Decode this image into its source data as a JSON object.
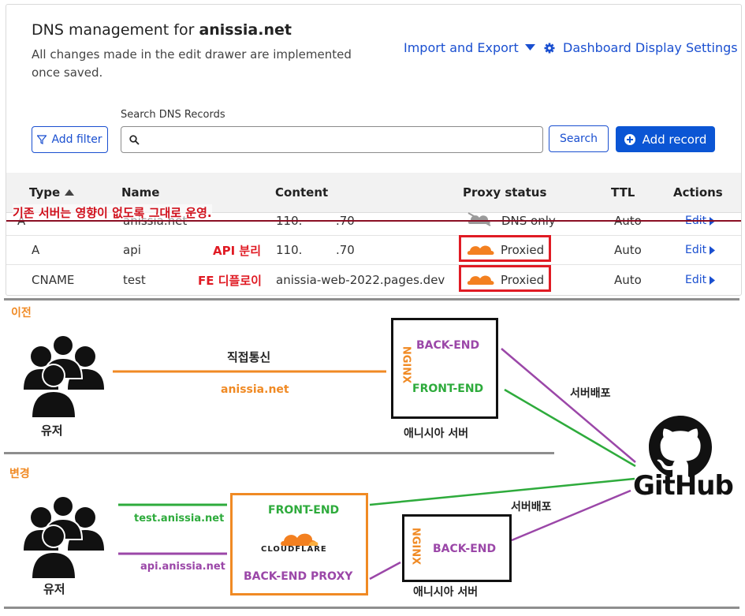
{
  "header": {
    "title_prefix": "DNS management for ",
    "title_domain": "anissia.net",
    "subtitle": "All changes made in the edit drawer are implemented once saved.",
    "import_export": "Import and Export",
    "dashboard_settings": "Dashboard Display Settings"
  },
  "toolbar": {
    "add_filter": "Add filter",
    "search_label": "Search DNS Records",
    "search_value": "",
    "search_button": "Search",
    "add_record": "Add record"
  },
  "table": {
    "columns": [
      "Type",
      "Name",
      "Content",
      "Proxy status",
      "TTL",
      "Actions"
    ],
    "rows": [
      {
        "type": "A",
        "name": "anissia.net",
        "content_a": "110.",
        "content_b": ".70",
        "proxy": "DNS only",
        "ttl": "Auto",
        "action": "Edit"
      },
      {
        "type": "A",
        "name": "api",
        "content_a": "110.",
        "content_b": ".70",
        "proxy": "Proxied",
        "ttl": "Auto",
        "action": "Edit"
      },
      {
        "type": "CNAME",
        "name": "test",
        "content_a": "anissia-web-2022.pages.dev",
        "content_b": "",
        "proxy": "Proxied",
        "ttl": "Auto",
        "action": "Edit"
      }
    ]
  },
  "annotations": {
    "strike_note": "기존 서버는 영향이 없도록 그대로 운영.",
    "api_note": "API 분리",
    "fe_note": "FE 디플로이"
  },
  "diagram_before": {
    "label": "이전",
    "user": "유저",
    "link_top": "직접통신",
    "link_bottom": "anissia.net",
    "nginx": "NGINX",
    "backend": "BACK-END",
    "frontend": "FRONT-END",
    "server": "애니시아 서버",
    "deploy": "서버배포"
  },
  "diagram_after": {
    "label": "변경",
    "user": "유저",
    "link_test": "test.anissia.net",
    "link_api": "api.anissia.net",
    "frontend": "FRONT-END",
    "cloudflare": "CLOUDFLARE",
    "backend_proxy": "BACK-END PROXY",
    "nginx": "NGINX",
    "backend": "BACK-END",
    "server": "애니시아 서버",
    "deploy": "서버배포"
  },
  "github": {
    "label": "GitHub"
  },
  "colors": {
    "accent": "#1a4fd0",
    "primary_button": "#0b55d4",
    "highlight_red": "#e01b24",
    "cloud_orange": "#f38020",
    "diagram_orange": "#f08a24",
    "diagram_purple": "#9b47a8",
    "diagram_green": "#2eab3c"
  },
  "icons": [
    "filter-icon",
    "search-icon",
    "plus-circle-icon",
    "chevron-down-icon",
    "gear-icon",
    "sort-up-icon",
    "cloud-icon",
    "caret-right-icon",
    "users-icon",
    "github-icon"
  ]
}
